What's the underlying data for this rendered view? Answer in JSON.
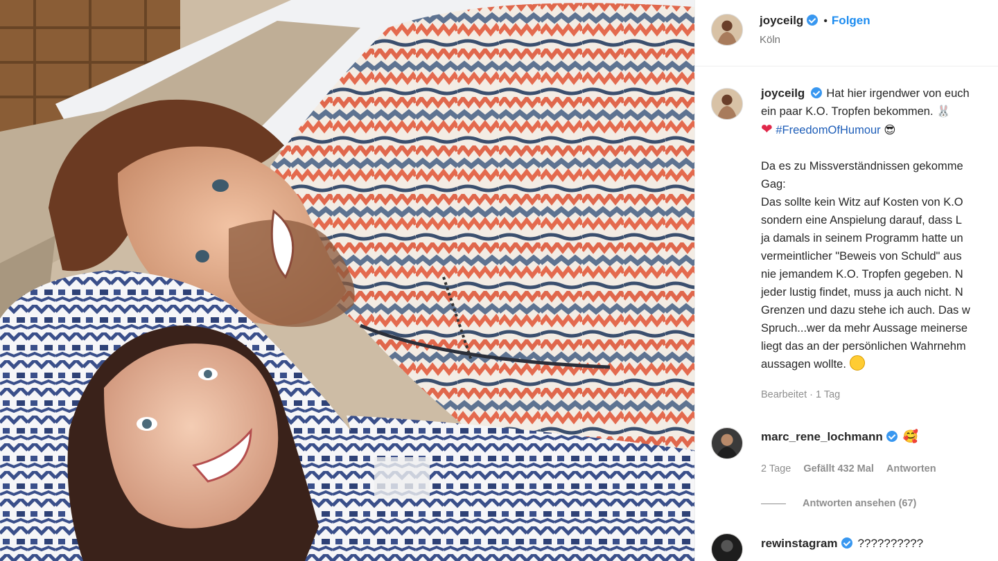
{
  "post": {
    "author": "joyceilg",
    "follow_label": "Folgen",
    "separator": "•",
    "location": "Köln",
    "caption_lines": [
      "Hat hier irgendwer von euch",
      "ein paar K.O. Tropfen bekommen."
    ],
    "hashtag": "#FreedomOfHumour",
    "body_lines": [
      "Da es zu Missverständnissen gekomme",
      "Gag:",
      "Das sollte kein Witz auf Kosten von K.O",
      "sondern eine Anspielung darauf, dass L",
      "ja damals in seinem Programm hatte un",
      "vermeintlicher \"Beweis von Schuld\" aus",
      "nie jemandem K.O. Tropfen gegeben. N",
      "jeder lustig findet, muss ja auch nicht. N",
      "Grenzen und dazu stehe ich auch. Das w",
      "Spruch...wer da mehr Aussage meinerse",
      "liegt das an der persönlichen Wahrnehm",
      "aussagen wollte."
    ],
    "edited_label": "Bearbeitet · 1 Tag"
  },
  "comments": [
    {
      "user": "marc_rene_lochmann",
      "text": "🥰",
      "age": "2 Tage",
      "likes": "Gefällt 432 Mal",
      "reply_label": "Antworten",
      "view_replies": "Antworten ansehen (67)"
    },
    {
      "user": "rewinstagram",
      "text": "??????????"
    }
  ],
  "colors": {
    "link_blue": "#1d8cf0",
    "hashtag_blue": "#1d5db8",
    "verified_blue": "#3897f0",
    "muted_gray": "#8e8e8e"
  },
  "icons": {
    "verified": "verified-badge-icon",
    "heart": "red-heart-emoji",
    "smile": "smiling-face-emoji"
  }
}
